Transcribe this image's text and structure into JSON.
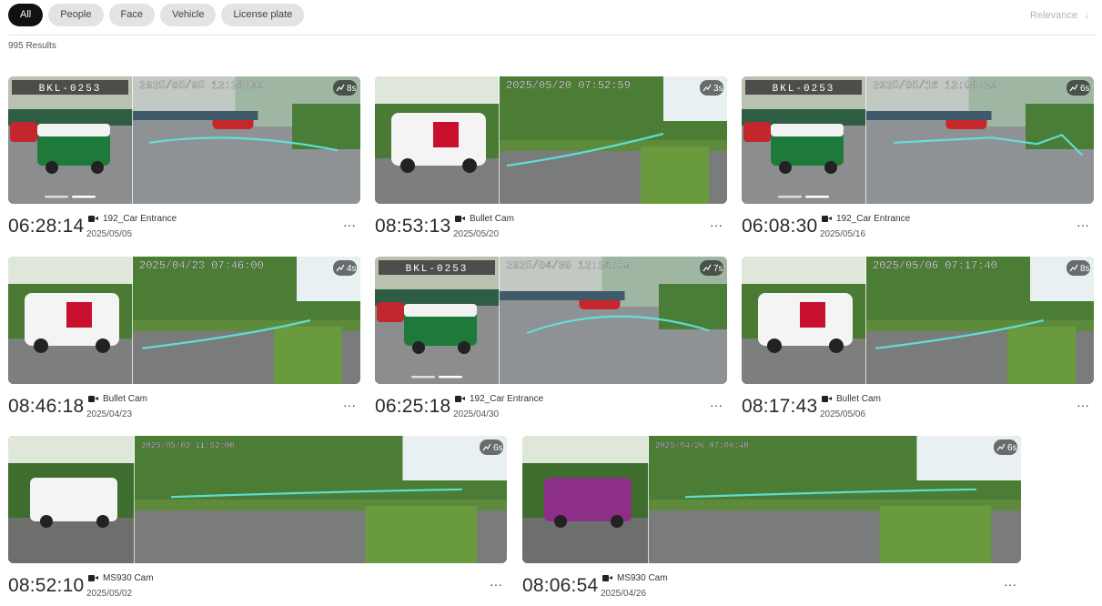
{
  "filters": {
    "all": "All",
    "people": "People",
    "face": "Face",
    "vehicle": "Vehicle",
    "license_plate": "License plate"
  },
  "sort": {
    "label": "Relevance",
    "arrow": "↓"
  },
  "results_count": "995 Results",
  "more_label": "···",
  "clips": [
    {
      "time": "06:28:14",
      "camera": "192_Car Entrance",
      "date": "2025/05/05",
      "overlay_ts": "2025/05/05 12:28:00",
      "duration": "8s",
      "plate": "BKL-0253",
      "scene": "lot",
      "track": "curve-right"
    },
    {
      "time": "08:53:13",
      "camera": "Bullet Cam",
      "date": "2025/05/20",
      "overlay_ts": "2025/05/20 07:52:59",
      "duration": "3s",
      "plate": "",
      "scene": "road",
      "track": "short-left"
    },
    {
      "time": "06:08:30",
      "camera": "192_Car Entrance",
      "date": "2025/05/16",
      "overlay_ts": "2025/05/16 12:08:20",
      "duration": "6s",
      "plate": "BKL-0253",
      "scene": "lot",
      "track": "wave-right"
    },
    {
      "time": "08:46:18",
      "camera": "Bullet Cam",
      "date": "2025/04/23",
      "overlay_ts": "2025/04/23 07:46:00",
      "duration": "4s",
      "plate": "",
      "scene": "road",
      "track": "diag-up"
    },
    {
      "time": "06:25:18",
      "camera": "192_Car Entrance",
      "date": "2025/04/30",
      "overlay_ts": "2025/04/30 12:24:59",
      "duration": "7s",
      "plate": "BKL-0253",
      "scene": "lot",
      "track": "arc-right"
    },
    {
      "time": "08:17:43",
      "camera": "Bullet Cam",
      "date": "2025/05/06",
      "overlay_ts": "2025/05/06 07:17:40",
      "duration": "8s",
      "plate": "",
      "scene": "road",
      "track": "diag-up"
    },
    {
      "time": "08:52:10",
      "camera": "MS930 Cam",
      "date": "2025/05/02",
      "overlay_ts": "2025/05/02 11:52:00",
      "duration": "6s",
      "plate": "",
      "scene": "wide",
      "track": "flat-long"
    },
    {
      "time": "08:06:54",
      "camera": "MS930 Cam",
      "date": "2025/04/26",
      "overlay_ts": "2025/04/26 07:06:40",
      "duration": "6s",
      "plate": "",
      "scene": "wide",
      "track": "flat-long"
    }
  ],
  "colors": {
    "chip_active_bg": "#111111",
    "chip_bg": "#e3e3e3",
    "track_color": "#5ee8e0",
    "plate_bg": "#3a3a3a"
  }
}
